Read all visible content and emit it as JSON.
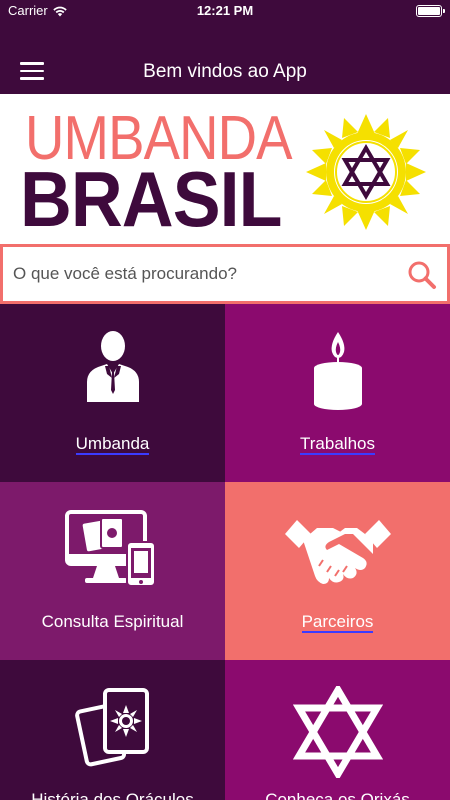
{
  "status_bar": {
    "carrier": "Carrier",
    "time": "12:21 PM"
  },
  "nav": {
    "title": "Bem vindos ao App",
    "menu_icon": "hamburger-menu-icon"
  },
  "logo": {
    "line1": "UMBANDA",
    "line2": "BRASIL",
    "emblem": "star-of-david-sun-icon"
  },
  "search": {
    "placeholder": "O que você está procurando?",
    "icon": "search-icon"
  },
  "colors": {
    "dark_purple": "#3e0a3c",
    "magenta": "#8b0a6e",
    "mid_purple": "#7d1a6b",
    "coral": "#f26f6c",
    "sun_yellow": "#f5e000"
  },
  "tiles": [
    {
      "label": "Umbanda",
      "icon": "man-in-suit-icon"
    },
    {
      "label": "Trabalhos",
      "icon": "candle-icon"
    },
    {
      "label": "Consulta Espiritual",
      "icon": "computer-tarot-cards-icon"
    },
    {
      "label": "Parceiros",
      "icon": "handshake-icon"
    },
    {
      "label": "História dos Oráculos",
      "icon": "tarot-cards-icon"
    },
    {
      "label": "Conheça os Orixás",
      "icon": "star-of-david-icon"
    }
  ]
}
